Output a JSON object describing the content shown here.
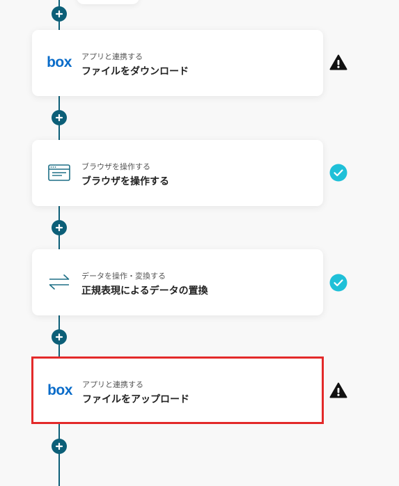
{
  "colors": {
    "connector": "#0c5f78",
    "box_brand": "#0a6cc9",
    "success": "#1fc0d8",
    "warning": "#111111",
    "selected_border": "#e32a2a"
  },
  "steps": [
    {
      "icon": "box-logo",
      "logo_text": "box",
      "subtitle": "アプリと連携する",
      "title": "ファイルをダウンロード",
      "status": "warning"
    },
    {
      "icon": "browser-window-icon",
      "subtitle": "ブラウザを操作する",
      "title": "ブラウザを操作する",
      "status": "success"
    },
    {
      "icon": "transform-arrows-icon",
      "subtitle": "データを操作・変換する",
      "title": "正規表現によるデータの置換",
      "status": "success"
    },
    {
      "icon": "box-logo",
      "logo_text": "box",
      "subtitle": "アプリと連携する",
      "title": "ファイルをアップロード",
      "status": "warning",
      "selected": true
    }
  ]
}
